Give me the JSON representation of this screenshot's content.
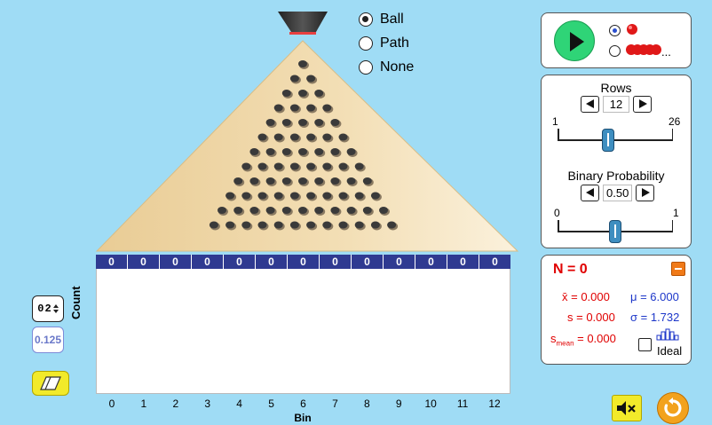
{
  "display_mode": {
    "options": [
      {
        "label": "Ball",
        "selected": true
      },
      {
        "label": "Path",
        "selected": false
      },
      {
        "label": "None",
        "selected": false
      }
    ]
  },
  "bins": {
    "counts": [
      "0",
      "0",
      "0",
      "0",
      "0",
      "0",
      "0",
      "0",
      "0",
      "0",
      "0",
      "0",
      "0"
    ],
    "labels": [
      "0",
      "1",
      "2",
      "3",
      "4",
      "5",
      "6",
      "7",
      "8",
      "9",
      "10",
      "11",
      "12"
    ]
  },
  "histogram": {
    "x_title": "Bin",
    "y_title": "Count"
  },
  "left_tools": {
    "counter_label": "02",
    "fraction_label": "0.125"
  },
  "play_panel": {
    "single_ball_selected": true,
    "many_balls_suffix": "..."
  },
  "rows": {
    "label": "Rows",
    "value": "12",
    "min": "1",
    "max": "26",
    "fraction": 0.44
  },
  "probability": {
    "label": "Binary Probability",
    "value": "0.50",
    "min": "0",
    "max": "1",
    "fraction": 0.5
  },
  "stats": {
    "n_label": "N = 0",
    "mean_sample": "x̄ = 0.000",
    "mu": "μ = 6.000",
    "s": "s = 0.000",
    "sigma": "σ = 1.732",
    "s_mean_prefix": "s",
    "s_mean_sub": "mean",
    "s_mean_value": " = 0.000",
    "ideal_label": "Ideal"
  },
  "colors": {
    "background": "#9fdcf5",
    "board": "#f0d8ab",
    "bin_bar": "#2f3a91",
    "play": "#2fd477",
    "stat_red": "#e00000",
    "stat_blue": "#1c36c9"
  },
  "board": {
    "peg_rows": 12
  }
}
